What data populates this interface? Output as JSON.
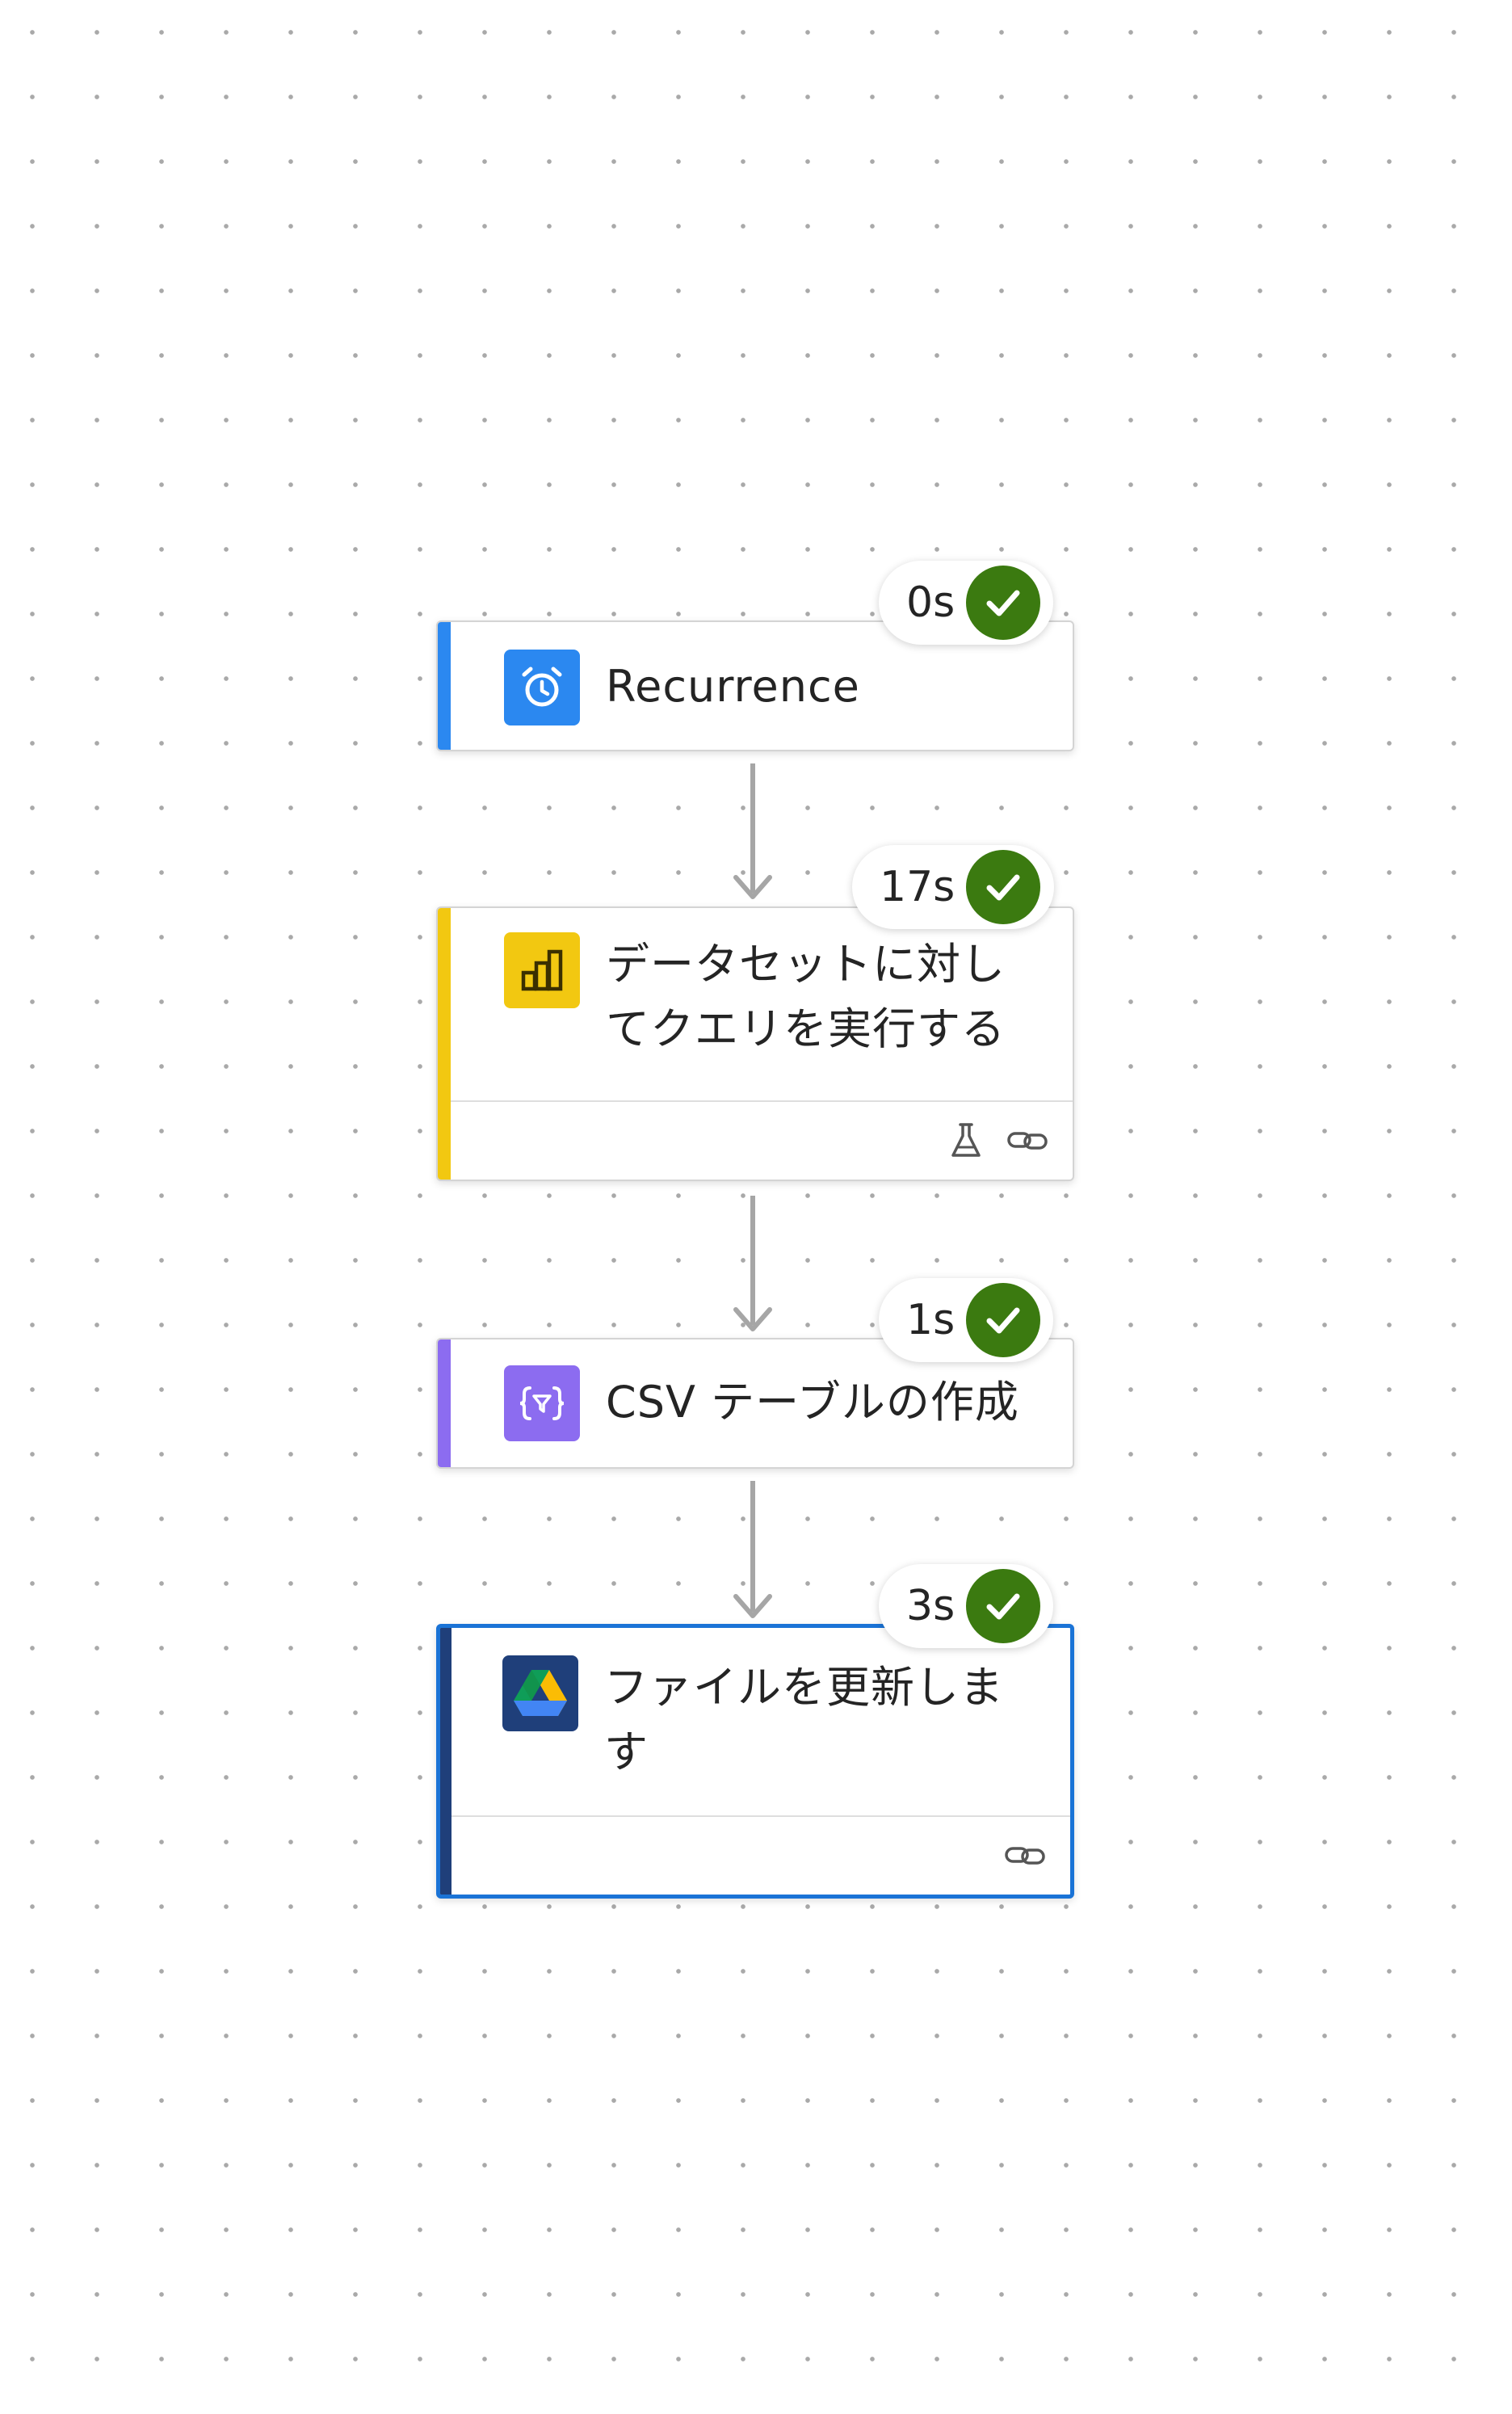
{
  "flow": {
    "steps": [
      {
        "title": "Recurrence",
        "duration": "0s",
        "status_icon": "check-icon",
        "icon": "alarm-clock-icon",
        "accent": "#2b88f0"
      },
      {
        "title": "データセットに対してクエリを実行する",
        "duration": "17s",
        "status_icon": "check-icon",
        "icon": "power-bi-icon",
        "accent": "#f2c811",
        "footer_icons": [
          "flask-icon",
          "link-icon"
        ]
      },
      {
        "title": "CSV テーブルの作成",
        "duration": "1s",
        "status_icon": "check-icon",
        "icon": "data-operation-icon",
        "accent": "#8c6cf0"
      },
      {
        "title": "ファイルを更新します",
        "duration": "3s",
        "status_icon": "check-icon",
        "icon": "google-drive-icon",
        "accent": "#1f3f7a",
        "footer_icons": [
          "link-icon"
        ],
        "selected": true
      }
    ]
  },
  "colors": {
    "success": "#3b7a10",
    "selection": "#1a73d6",
    "connector": "#a6a6a6"
  }
}
